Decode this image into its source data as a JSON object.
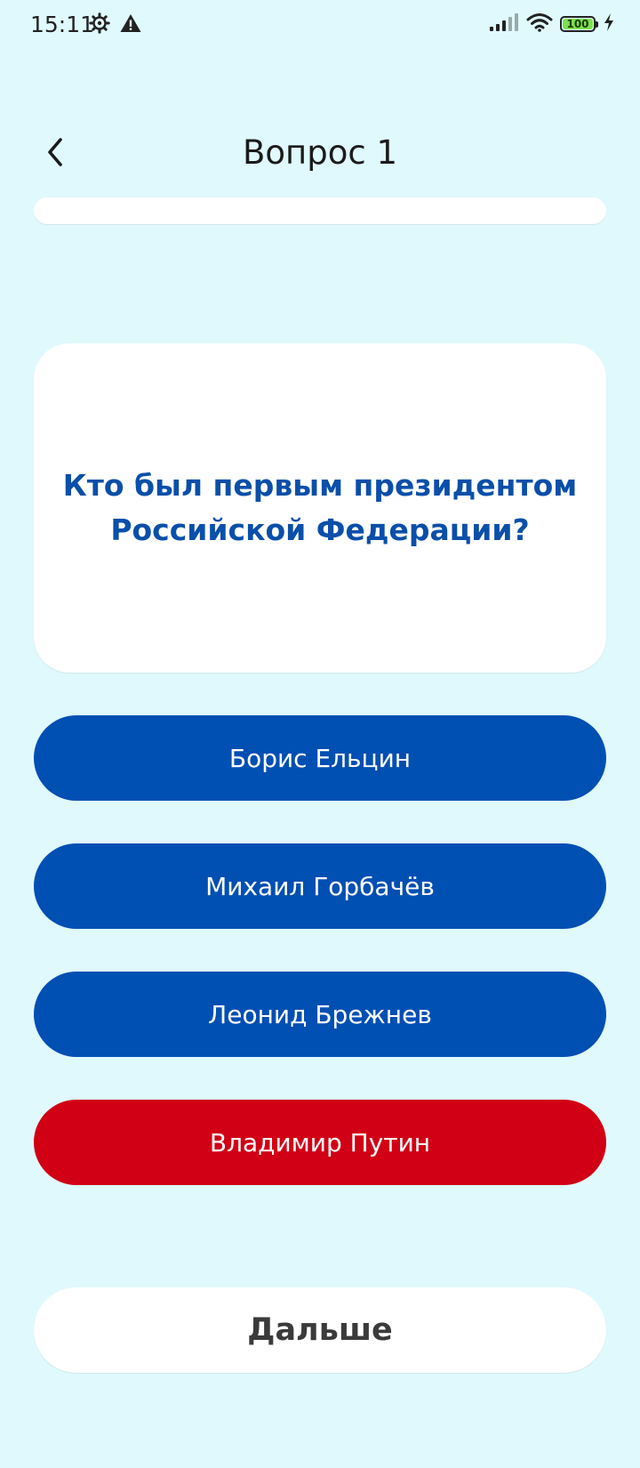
{
  "status_bar": {
    "time": "15:11",
    "battery_level": "100",
    "icons": [
      "settings-gear-icon",
      "warning-icon",
      "signal-icon",
      "wifi-icon",
      "battery-icon",
      "charging-icon"
    ]
  },
  "header": {
    "title": "Вопрос 1",
    "back_icon": "chevron-left-icon"
  },
  "progress": {
    "value": 0
  },
  "question": {
    "text": "Кто был первым президентом Российской Федерации?"
  },
  "answers": [
    {
      "label": "Борис Ельцин",
      "color": "#004fb3"
    },
    {
      "label": "Михаил Горбачёв",
      "color": "#004fb3"
    },
    {
      "label": "Леонид Брежнев",
      "color": "#004fb3"
    },
    {
      "label": "Владимир Путин",
      "color": "#d10015"
    }
  ],
  "next_button": {
    "label": "Дальше"
  },
  "colors": {
    "background": "#e0f9fd",
    "accent_blue": "#004fb3",
    "question_text": "#0a4fa9",
    "selected_red": "#d10015"
  }
}
